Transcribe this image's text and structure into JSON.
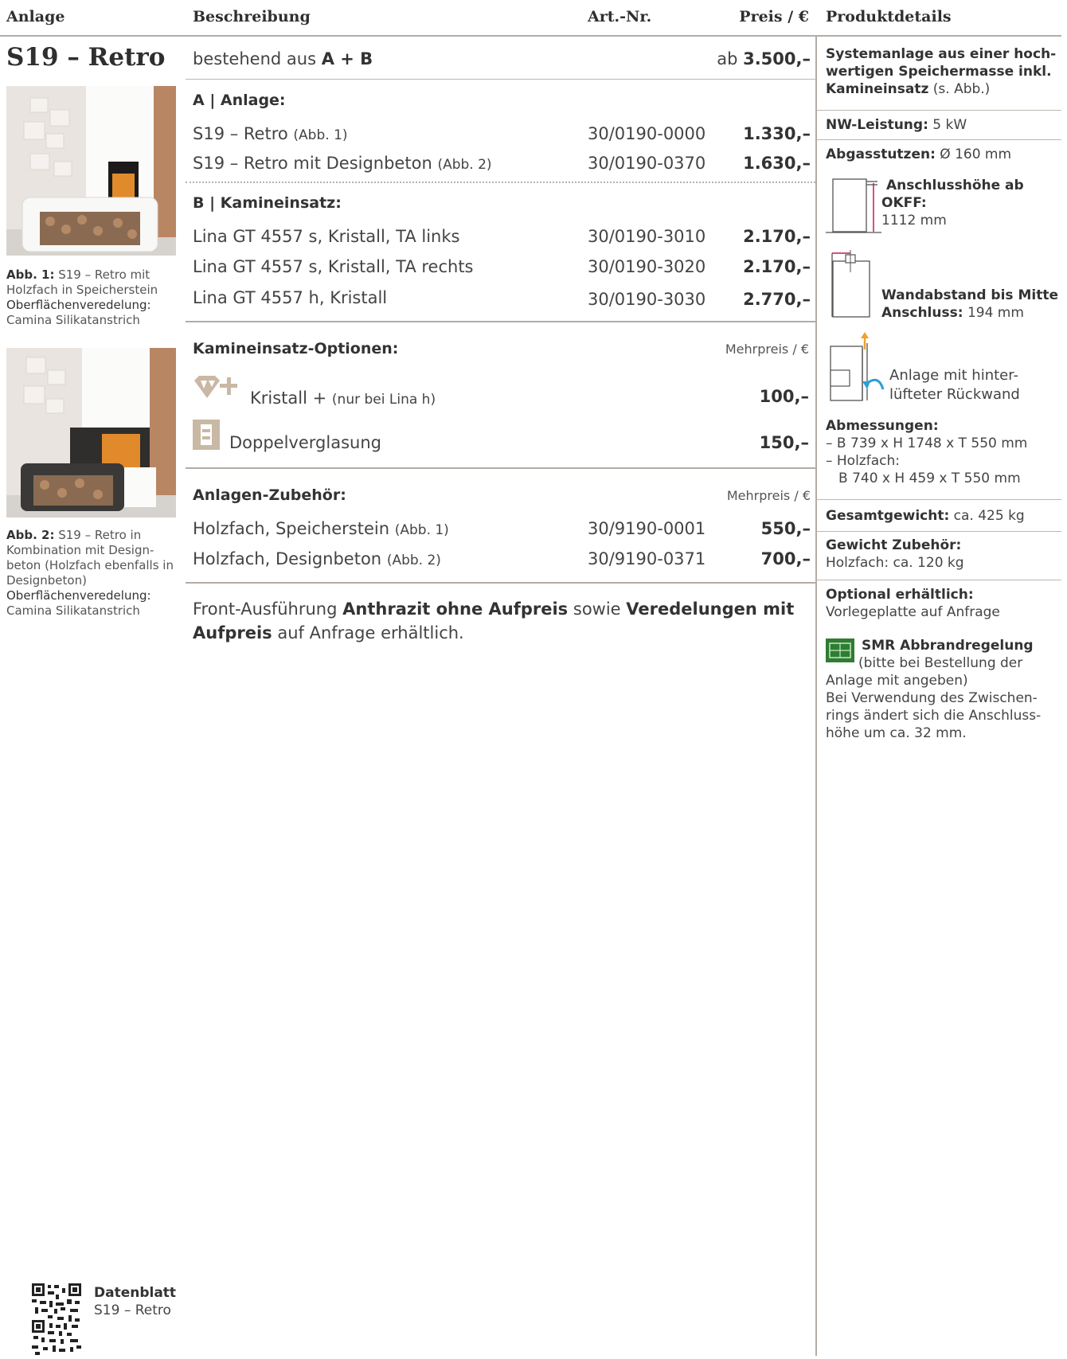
{
  "headers": {
    "anlage": "Anlage",
    "beschreibung": "Beschreibung",
    "artnr": "Art.-Nr.",
    "preis": "Preis / €",
    "produktdetails": "Produktdetails"
  },
  "product": {
    "name": "S19 – Retro",
    "consists_prefix": "bestehend aus",
    "consists_bold": "A + B",
    "price_prefix": "ab",
    "price": "3.500,–"
  },
  "captions": {
    "abb1": {
      "label": "Abb. 1:",
      "text1": "S19 – Retro mit Holzfach in Speicherstein",
      "label2": "Oberflächenveredelung:",
      "text2": "Camina Silikatanstrich"
    },
    "abb2": {
      "label": "Abb. 2:",
      "text1": "S19 – Retro in Kombination mit Design-beton (Holzfach ebenfalls in Designbeton)",
      "label2": "Oberflächenveredelung:",
      "text2": "Camina Silikatanstrich"
    }
  },
  "section_a": {
    "title": "A | Anlage:",
    "rows": [
      {
        "desc": "S19 – Retro",
        "note": "(Abb. 1)",
        "art": "30/0190-0000",
        "price": "1.330,–"
      },
      {
        "desc": "S19 – Retro mit Designbeton",
        "note": "(Abb. 2)",
        "art": "30/0190-0370",
        "price": "1.630,–"
      }
    ]
  },
  "section_b": {
    "title": "B | Kamineinsatz:",
    "rows": [
      {
        "desc": "Lina GT 4557 s, Kristall, TA links",
        "art": "30/0190-3010",
        "price": "2.170,–"
      },
      {
        "desc": "Lina GT 4557 s, Kristall, TA rechts",
        "art": "30/0190-3020",
        "price": "2.170,–"
      },
      {
        "desc": "Lina GT 4557 h, Kristall",
        "art": "30/0190-3030",
        "price": "2.770,–"
      }
    ]
  },
  "options": {
    "title": "Kamineinsatz-Optionen:",
    "mehrpreis": "Mehrpreis / €",
    "rows": [
      {
        "desc": "Kristall +",
        "note": "(nur bei Lina h)",
        "price": "100,–",
        "icon": "diamond-plus-icon"
      },
      {
        "desc": "Doppelverglasung",
        "price": "150,–",
        "icon": "double-glazing-icon"
      }
    ]
  },
  "accessories": {
    "title": "Anlagen-Zubehör:",
    "mehrpreis": "Mehrpreis / €",
    "rows": [
      {
        "desc": "Holzfach, Speicherstein",
        "note": "(Abb. 1)",
        "art": "30/9190-0001",
        "price": "550,–"
      },
      {
        "desc": "Holzfach, Designbeton",
        "note": "(Abb. 2)",
        "art": "30/9190-0371",
        "price": "700,–"
      }
    ]
  },
  "footnote": {
    "t1": "Front-Ausführung",
    "b1": "Anthrazit ohne Aufpreis",
    "t2": "sowie",
    "b2": "Veredelungen mit Aufpreis",
    "t3": "auf Anfrage erhältlich."
  },
  "details": {
    "intro_bold1": "Systemanlage aus einer hoch-",
    "intro_bold2": "wertigen Speichermasse inkl.",
    "intro_bold3": "Kamineinsatz",
    "intro_text": "(s. Abb.)",
    "nw_label": "NW-Leistung:",
    "nw_value": "5 kW",
    "abgas_label": "Abgasstutzen:",
    "abgas_value": "Ø 160 mm",
    "anschluss_label": "Anschlusshöhe ab OKFF:",
    "anschluss_value": "1112 mm",
    "wand_label1": "Wandabstand bis Mitte",
    "wand_label2": "Anschluss:",
    "wand_value": "194 mm",
    "hinter1": "Anlage mit hinter-",
    "hinter2": "lüfteter Rückwand",
    "abm_label": "Abmessungen:",
    "abm1": "– B 739 x H 1748 x T 550 mm",
    "abm2": "– Holzfach:",
    "abm3": "B 740 x H 459 x T 550 mm",
    "gew_label": "Gesamtgewicht:",
    "gew_value": "ca. 425 kg",
    "zub_label": "Gewicht Zubehör:",
    "zub_value": "Holzfach: ca. 120 kg",
    "opt_label": "Optional erhältlich:",
    "opt_value": "Vorlegeplatte auf Anfrage",
    "smr_label": "SMR Abbrandregelung",
    "smr1": "(bitte bei Bestellung der",
    "smr2": "Anlage mit angeben)",
    "zw1": "Bei Verwendung des Zwischen-",
    "zw2": "rings ändert sich die Anschluss-",
    "zw3": "höhe um ca. 32 mm."
  },
  "datasheet": {
    "label": "Datenblatt",
    "name": "S19 – Retro"
  },
  "colors": {
    "rule": "#b3aca6",
    "smr_green": "#2e7d32",
    "icon_tan": "#c9b8a4"
  }
}
